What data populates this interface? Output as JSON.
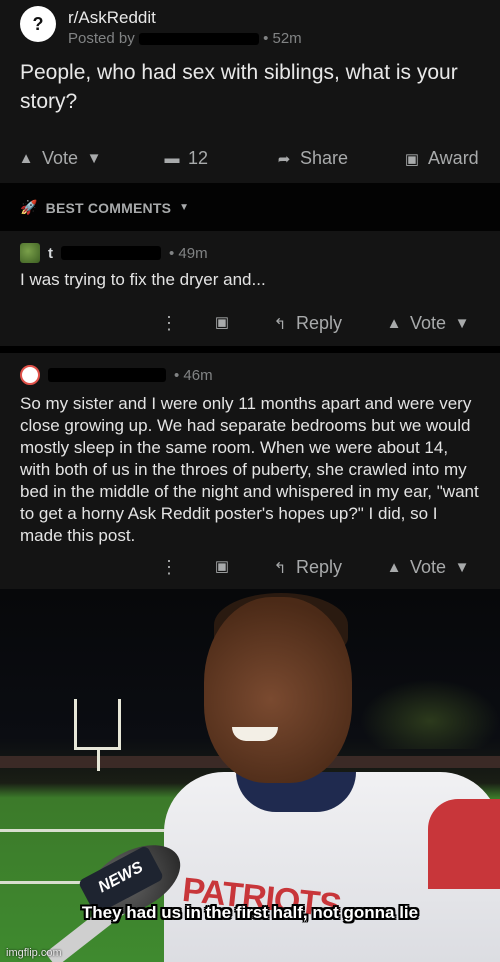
{
  "post": {
    "subreddit": "r/AskReddit",
    "posted_by_prefix": "Posted by",
    "age": "• 52m",
    "title": "People, who had sex with siblings, what is your story?",
    "subreddit_icon": "question-mark-icon",
    "actions": {
      "vote_label": "Vote",
      "comment_count": "12",
      "share_label": "Share",
      "award_label": "Award"
    }
  },
  "sort": {
    "label": "BEST COMMENTS"
  },
  "comments": [
    {
      "username_visible": "t",
      "age": "• 49m",
      "body": "I was trying to fix the dryer and...",
      "more_label": "⋮",
      "reply_label": "Reply",
      "vote_label": "Vote"
    },
    {
      "age": "• 46m",
      "body": "So my sister and I were only 11 months apart and were very close growing up. We had separate bedrooms but we would mostly sleep in the same room. When we were about 14, with both of us in the throes of puberty, she crawled into my bed in the middle of the night and whispered in my ear, \"want to get a horny Ask Reddit poster's hopes up?\" I did, so I made this post.",
      "more_label": "⋮",
      "reply_label": "Reply",
      "vote_label": "Vote"
    }
  ],
  "meme": {
    "caption": "They had us in the first half, not gonna lie",
    "mic_label": "NEWS",
    "jersey_text": "PATRIOTS",
    "watermark": "imgflip.com"
  },
  "colors": {
    "post_bg": "#141414",
    "page_bg": "#030303",
    "meta_text": "#818384",
    "icon": "#a8aaab"
  }
}
